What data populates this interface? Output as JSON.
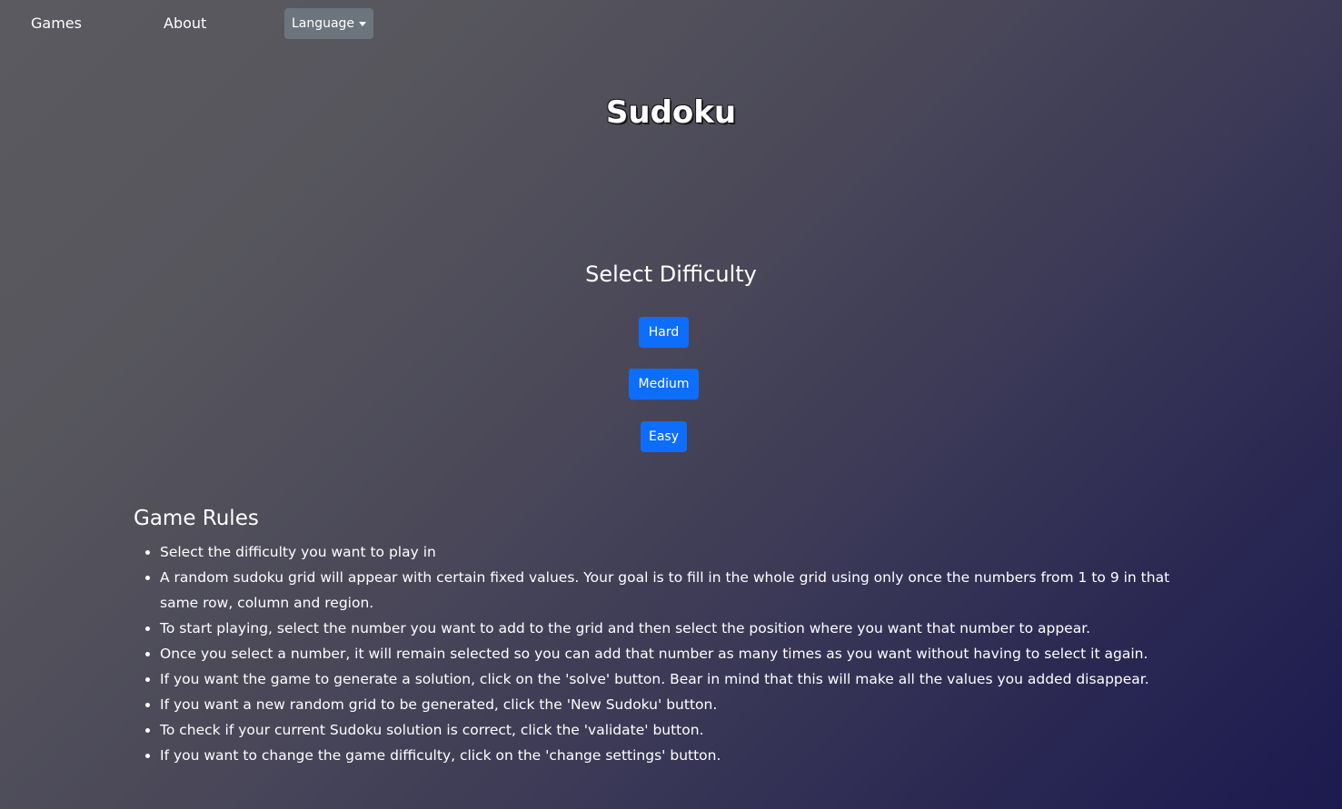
{
  "nav": {
    "games": "Games",
    "about": "About",
    "language": "Language"
  },
  "title": "Sudoku",
  "difficulty": {
    "heading": "Select Difficulty",
    "hard": "Hard",
    "medium": "Medium",
    "easy": "Easy"
  },
  "rules": {
    "heading": "Game Rules",
    "items": [
      "Select the difficulty you want to play in",
      "A random sudoku grid will appear with certain fixed values. Your goal is to fill in the whole grid using only once the numbers from 1 to 9 in that same row, column and region.",
      "To start playing, select the number you want to add to the grid and then select the position where you want that number to appear.",
      "Once you select a number, it will remain selected so you can add that number as many times as you want without having to select it again.",
      "If you want the game to generate a solution, click on the 'solve' button. Bear in mind that this will make all the values you added disappear.",
      "If you want a new random grid to be generated, click the 'New Sudoku' button.",
      "To check if your current Sudoku solution is correct, click the 'validate' button.",
      "If you want to change the game difficulty, click on the 'change settings' button."
    ]
  },
  "colors": {
    "primary_button": "#0d6efd",
    "secondary_button": "#6c757d",
    "background_start": "#5a5a60",
    "background_end": "#1c1a4f"
  },
  "icons": {
    "language_caret": "caret-down-icon"
  }
}
